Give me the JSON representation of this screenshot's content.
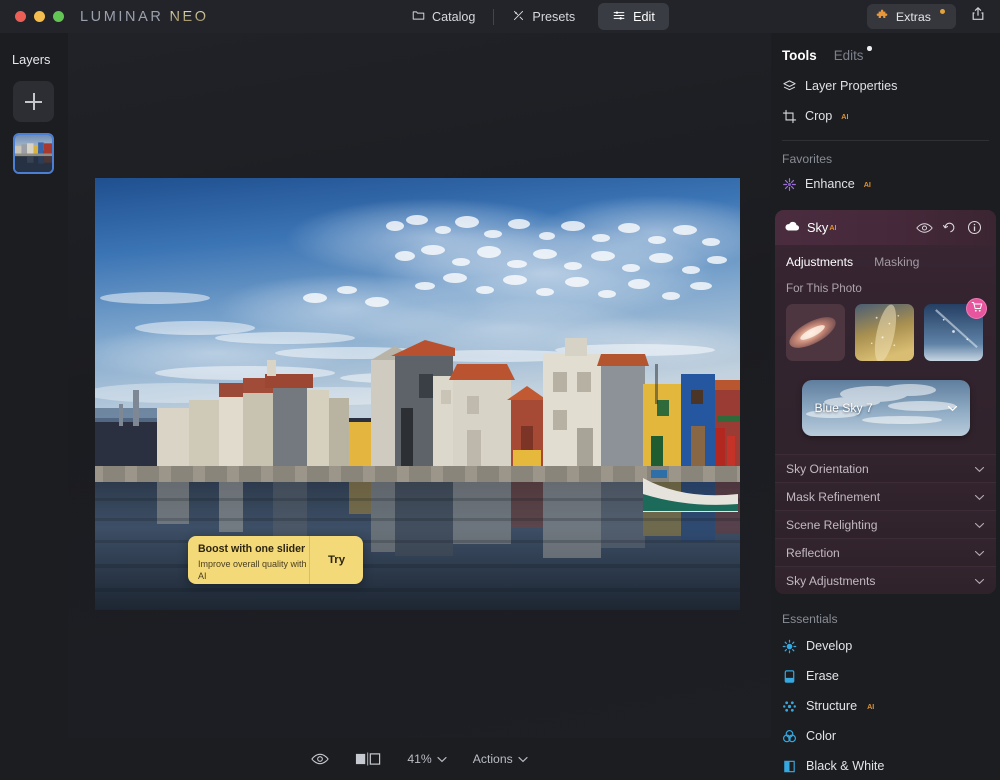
{
  "window": {
    "brand_primary": "LUMINAR",
    "brand_secondary": "NEO",
    "traffic_lights": [
      "close",
      "minimize",
      "maximize"
    ]
  },
  "nav": {
    "items": [
      {
        "label": "Catalog",
        "icon": "folder-icon",
        "active": false
      },
      {
        "label": "Presets",
        "icon": "presets-icon",
        "active": false
      },
      {
        "label": "Edit",
        "icon": "sliders-icon",
        "active": true
      }
    ],
    "extras_label": "Extras",
    "extras_icon": "puzzle-icon",
    "share_icon": "share-icon"
  },
  "sidebar": {
    "title": "Layers",
    "add_button_label": "+",
    "layers": [
      {
        "name": "photo-layer",
        "selected": true
      }
    ]
  },
  "canvas": {
    "tooltip": {
      "title": "Boost with one slider",
      "subtitle": "Improve overall quality with AI",
      "action": "Try",
      "background": "#f4d978"
    }
  },
  "bottombar": {
    "preview_icon": "eye-icon",
    "compare_icon": "before-after-icon",
    "zoom_level": "41%",
    "actions_label": "Actions"
  },
  "tools": {
    "tabs": [
      {
        "label": "Tools",
        "active": true,
        "badge": false
      },
      {
        "label": "Edits",
        "active": false,
        "badge": true
      }
    ],
    "top_items": [
      {
        "label": "Layer Properties",
        "icon": "layers-icon",
        "ai": false
      },
      {
        "label": "Crop",
        "icon": "crop-icon",
        "ai": true
      }
    ],
    "favorites_label": "Favorites",
    "favorites": [
      {
        "label": "Enhance",
        "icon": "sparkle-icon",
        "ai": true
      }
    ]
  },
  "sky_panel": {
    "title": "Sky",
    "icon": "cloud-icon",
    "ai": true,
    "header_icons": [
      "eye-icon",
      "undo-icon",
      "info-icon"
    ],
    "tabs": [
      {
        "label": "Adjustments",
        "active": true
      },
      {
        "label": "Masking",
        "active": false
      }
    ],
    "for_this_photo_label": "For This Photo",
    "thumbnails": [
      {
        "name": "nebula-sky-thumb",
        "locked": false
      },
      {
        "name": "milky-way-sky-thumb",
        "locked": false
      },
      {
        "name": "blue-night-sky-thumb",
        "locked": true,
        "badge_icon": "cart-icon"
      }
    ],
    "selected_sky": "Blue Sky 7",
    "selected_sky_chevron": "chevron-down-icon",
    "sections": [
      {
        "label": "Sky Orientation",
        "chevron": "chevron-down-icon"
      },
      {
        "label": "Mask Refinement",
        "chevron": "chevron-down-icon"
      },
      {
        "label": "Scene Relighting",
        "chevron": "chevron-down-icon"
      },
      {
        "label": "Reflection",
        "chevron": "chevron-down-icon"
      },
      {
        "label": "Sky Adjustments",
        "chevron": "chevron-down-icon"
      }
    ]
  },
  "essentials": {
    "label": "Essentials",
    "items": [
      {
        "label": "Develop",
        "icon": "develop-icon",
        "ai": false
      },
      {
        "label": "Erase",
        "icon": "erase-icon",
        "ai": false
      },
      {
        "label": "Structure",
        "icon": "structure-icon",
        "ai": true
      },
      {
        "label": "Color",
        "icon": "color-icon",
        "ai": false
      },
      {
        "label": "Black & White",
        "icon": "bw-icon",
        "ai": false
      }
    ]
  },
  "colors": {
    "accent_blue": "#4a7fd4",
    "ai_orange": "#e0922f",
    "sky_panel": "#3a2634",
    "tooltip_yellow": "#f4d978",
    "cart_pink": "#e7559f"
  }
}
